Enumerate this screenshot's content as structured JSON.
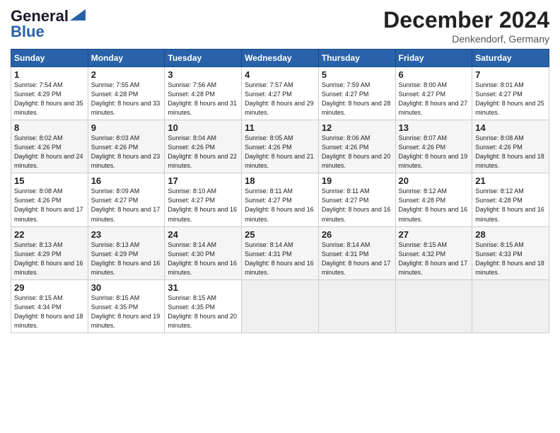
{
  "header": {
    "logo_line1": "General",
    "logo_line2": "Blue",
    "month_year": "December 2024",
    "location": "Denkendorf, Germany"
  },
  "days_of_week": [
    "Sunday",
    "Monday",
    "Tuesday",
    "Wednesday",
    "Thursday",
    "Friday",
    "Saturday"
  ],
  "weeks": [
    [
      {
        "day": "1",
        "sunrise": "7:54 AM",
        "sunset": "4:29 PM",
        "daylight": "8 hours and 35 minutes."
      },
      {
        "day": "2",
        "sunrise": "7:55 AM",
        "sunset": "4:28 PM",
        "daylight": "8 hours and 33 minutes."
      },
      {
        "day": "3",
        "sunrise": "7:56 AM",
        "sunset": "4:28 PM",
        "daylight": "8 hours and 31 minutes."
      },
      {
        "day": "4",
        "sunrise": "7:57 AM",
        "sunset": "4:27 PM",
        "daylight": "8 hours and 29 minutes."
      },
      {
        "day": "5",
        "sunrise": "7:59 AM",
        "sunset": "4:27 PM",
        "daylight": "8 hours and 28 minutes."
      },
      {
        "day": "6",
        "sunrise": "8:00 AM",
        "sunset": "4:27 PM",
        "daylight": "8 hours and 27 minutes."
      },
      {
        "day": "7",
        "sunrise": "8:01 AM",
        "sunset": "4:27 PM",
        "daylight": "8 hours and 25 minutes."
      }
    ],
    [
      {
        "day": "8",
        "sunrise": "8:02 AM",
        "sunset": "4:26 PM",
        "daylight": "8 hours and 24 minutes."
      },
      {
        "day": "9",
        "sunrise": "8:03 AM",
        "sunset": "4:26 PM",
        "daylight": "8 hours and 23 minutes."
      },
      {
        "day": "10",
        "sunrise": "8:04 AM",
        "sunset": "4:26 PM",
        "daylight": "8 hours and 22 minutes."
      },
      {
        "day": "11",
        "sunrise": "8:05 AM",
        "sunset": "4:26 PM",
        "daylight": "8 hours and 21 minutes."
      },
      {
        "day": "12",
        "sunrise": "8:06 AM",
        "sunset": "4:26 PM",
        "daylight": "8 hours and 20 minutes."
      },
      {
        "day": "13",
        "sunrise": "8:07 AM",
        "sunset": "4:26 PM",
        "daylight": "8 hours and 19 minutes."
      },
      {
        "day": "14",
        "sunrise": "8:08 AM",
        "sunset": "4:26 PM",
        "daylight": "8 hours and 18 minutes."
      }
    ],
    [
      {
        "day": "15",
        "sunrise": "8:08 AM",
        "sunset": "4:26 PM",
        "daylight": "8 hours and 17 minutes."
      },
      {
        "day": "16",
        "sunrise": "8:09 AM",
        "sunset": "4:27 PM",
        "daylight": "8 hours and 17 minutes."
      },
      {
        "day": "17",
        "sunrise": "8:10 AM",
        "sunset": "4:27 PM",
        "daylight": "8 hours and 16 minutes."
      },
      {
        "day": "18",
        "sunrise": "8:11 AM",
        "sunset": "4:27 PM",
        "daylight": "8 hours and 16 minutes."
      },
      {
        "day": "19",
        "sunrise": "8:11 AM",
        "sunset": "4:27 PM",
        "daylight": "8 hours and 16 minutes."
      },
      {
        "day": "20",
        "sunrise": "8:12 AM",
        "sunset": "4:28 PM",
        "daylight": "8 hours and 16 minutes."
      },
      {
        "day": "21",
        "sunrise": "8:12 AM",
        "sunset": "4:28 PM",
        "daylight": "8 hours and 16 minutes."
      }
    ],
    [
      {
        "day": "22",
        "sunrise": "8:13 AM",
        "sunset": "4:29 PM",
        "daylight": "8 hours and 16 minutes."
      },
      {
        "day": "23",
        "sunrise": "8:13 AM",
        "sunset": "4:29 PM",
        "daylight": "8 hours and 16 minutes."
      },
      {
        "day": "24",
        "sunrise": "8:14 AM",
        "sunset": "4:30 PM",
        "daylight": "8 hours and 16 minutes."
      },
      {
        "day": "25",
        "sunrise": "8:14 AM",
        "sunset": "4:31 PM",
        "daylight": "8 hours and 16 minutes."
      },
      {
        "day": "26",
        "sunrise": "8:14 AM",
        "sunset": "4:31 PM",
        "daylight": "8 hours and 17 minutes."
      },
      {
        "day": "27",
        "sunrise": "8:15 AM",
        "sunset": "4:32 PM",
        "daylight": "8 hours and 17 minutes."
      },
      {
        "day": "28",
        "sunrise": "8:15 AM",
        "sunset": "4:33 PM",
        "daylight": "8 hours and 18 minutes."
      }
    ],
    [
      {
        "day": "29",
        "sunrise": "8:15 AM",
        "sunset": "4:34 PM",
        "daylight": "8 hours and 18 minutes."
      },
      {
        "day": "30",
        "sunrise": "8:15 AM",
        "sunset": "4:35 PM",
        "daylight": "8 hours and 19 minutes."
      },
      {
        "day": "31",
        "sunrise": "8:15 AM",
        "sunset": "4:35 PM",
        "daylight": "8 hours and 20 minutes."
      },
      null,
      null,
      null,
      null
    ]
  ]
}
